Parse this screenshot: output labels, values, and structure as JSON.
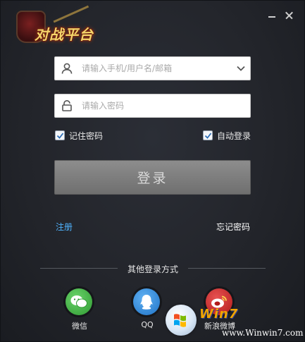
{
  "app": {
    "logo_text": "对战平台"
  },
  "login": {
    "username_placeholder": "请输入手机/用户名/邮箱",
    "password_placeholder": "请输入密码",
    "remember_label": "记住密码",
    "remember_checked": true,
    "auto_login_label": "自动登录",
    "auto_login_checked": true,
    "login_button": "登录",
    "register_link": "注册",
    "forgot_link": "忘记密码"
  },
  "other_login": {
    "title": "其他登录方式",
    "items": [
      {
        "label": "微信",
        "icon": "wechat-icon",
        "color": "#3aa83c"
      },
      {
        "label": "QQ",
        "icon": "qq-icon",
        "color": "#2a82d6"
      },
      {
        "label": "新浪微博",
        "icon": "weibo-icon",
        "color": "#d02a2a"
      }
    ]
  },
  "watermark": {
    "brand": "Win7",
    "url": "www.Winwin7.com"
  },
  "colors": {
    "link": "#4fb3ff",
    "accent_logo": "#f4d56a",
    "background": "#23252b"
  }
}
